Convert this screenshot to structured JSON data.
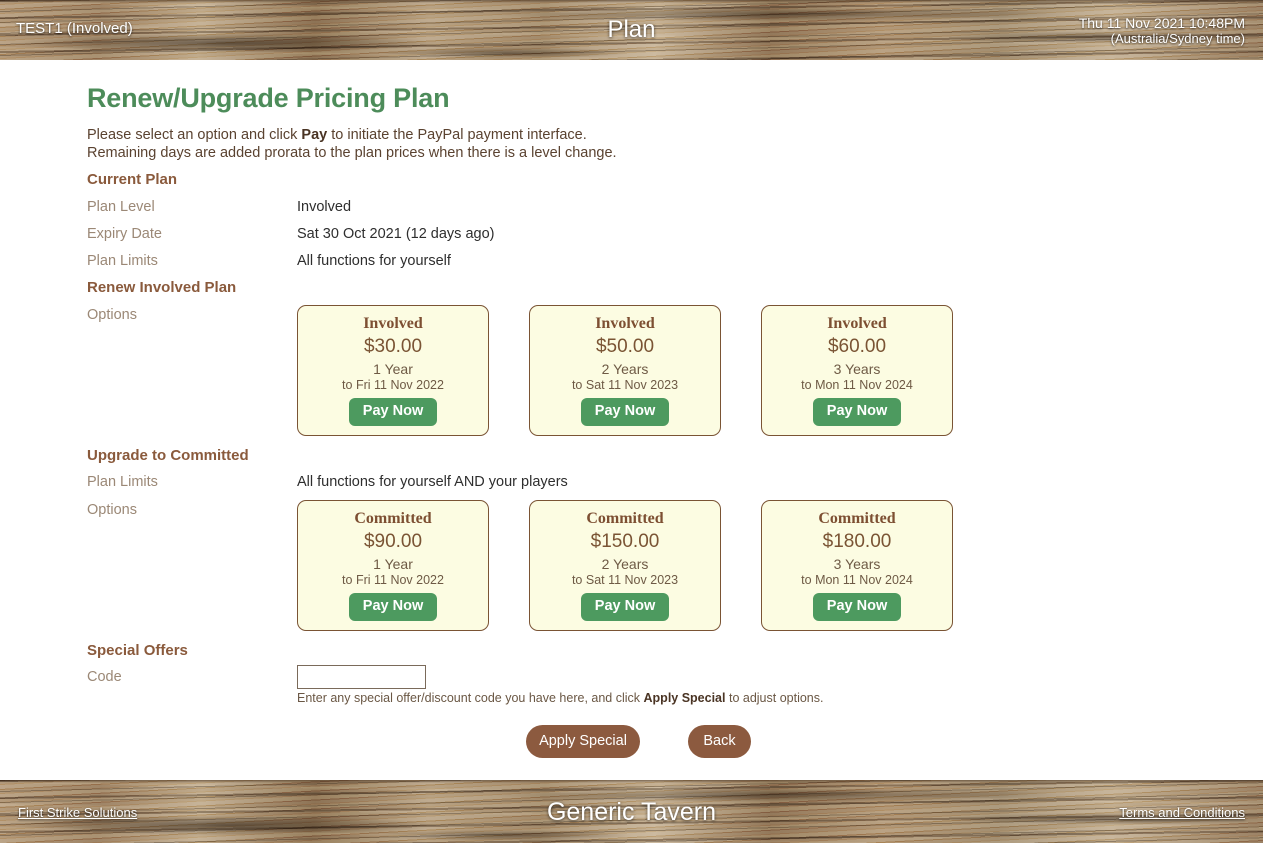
{
  "header": {
    "user": "TEST1 (Involved)",
    "title": "Plan",
    "datetime": "Thu 11 Nov 2021 10:48PM",
    "timezone": "(Australia/Sydney time)"
  },
  "page": {
    "title": "Renew/Upgrade Pricing Plan",
    "intro_line_1_before": "Please select an option and click ",
    "intro_line_1_bold": "Pay",
    "intro_line_1_after": " to initiate the PayPal payment interface.",
    "intro_line_2": "Remaining days are added prorata to the plan prices when there is a level change."
  },
  "current_plan": {
    "heading": "Current Plan",
    "rows": [
      {
        "label": "Plan Level",
        "value": "Involved"
      },
      {
        "label": "Expiry Date",
        "value": "Sat 30 Oct 2021 (12 days ago)"
      },
      {
        "label": "Plan Limits",
        "value": "All functions for yourself"
      }
    ]
  },
  "renew_section": {
    "heading": "Renew Involved Plan",
    "options_label": "Options",
    "cards": [
      {
        "name": "Involved",
        "price": "$30.00",
        "term": "1 Year",
        "until": "to Fri 11 Nov 2022",
        "button": "Pay Now"
      },
      {
        "name": "Involved",
        "price": "$50.00",
        "term": "2 Years",
        "until": "to Sat 11 Nov 2023",
        "button": "Pay Now"
      },
      {
        "name": "Involved",
        "price": "$60.00",
        "term": "3 Years",
        "until": "to Mon 11 Nov 2024",
        "button": "Pay Now"
      }
    ]
  },
  "upgrade_section": {
    "heading": "Upgrade to Committed",
    "plan_limits_label": "Plan Limits",
    "plan_limits_value": "All functions for yourself AND your players",
    "options_label": "Options",
    "cards": [
      {
        "name": "Committed",
        "price": "$90.00",
        "term": "1 Year",
        "until": "to Fri 11 Nov 2022",
        "button": "Pay Now"
      },
      {
        "name": "Committed",
        "price": "$150.00",
        "term": "2 Years",
        "until": "to Sat 11 Nov 2023",
        "button": "Pay Now"
      },
      {
        "name": "Committed",
        "price": "$180.00",
        "term": "3 Years",
        "until": "to Mon 11 Nov 2024",
        "button": "Pay Now"
      }
    ]
  },
  "special_offers": {
    "heading": "Special Offers",
    "code_label": "Code",
    "code_value": "",
    "code_placeholder": "",
    "hint_before": "Enter any special offer/discount code you have here, and click ",
    "hint_bold": "Apply Special",
    "hint_after": " to adjust options."
  },
  "actions": {
    "apply_special": "Apply Special",
    "back": "Back"
  },
  "footer": {
    "left_link": "First Strike Solutions",
    "title": "Generic Tavern",
    "right_link": "Terms and Conditions"
  },
  "colors": {
    "accent_green": "#4d8c5a",
    "pay_button_green": "#4d9a5f",
    "heading_brown": "#8a5a3c",
    "action_button_brown": "#8c5a3f",
    "card_background": "#fcfce2",
    "card_border": "#7a5434"
  }
}
